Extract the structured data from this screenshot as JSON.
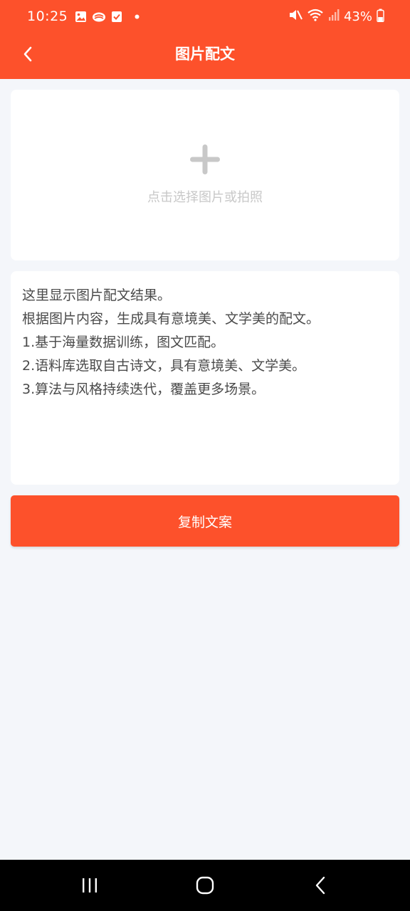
{
  "status_bar": {
    "time": "10:25",
    "battery_percent": "43%",
    "battery_level": 0.43,
    "notification_icons": [
      "image-icon",
      "cloud-icon",
      "check-square-icon",
      "dot-icon"
    ],
    "system_icons": [
      "mute-icon",
      "wifi-icon",
      "signal-icon",
      "battery-icon"
    ]
  },
  "nav": {
    "title": "图片配文",
    "back_icon": "back-chevron-icon"
  },
  "upload": {
    "icon": "plus-icon",
    "hint": "点击选择图片或拍照"
  },
  "result": {
    "lines": [
      "这里显示图片配文结果。",
      "根据图片内容，生成具有意境美、文学美的配文。",
      "1.基于海量数据训练，图文匹配。",
      "2.语料库选取自古诗文，具有意境美、文学美。",
      "3.算法与风格持续迭代，覆盖更多场景。"
    ]
  },
  "actions": {
    "copy_label": "复制文案"
  },
  "system_nav": {
    "icons": [
      "recent-apps-icon",
      "home-icon",
      "back-icon"
    ]
  },
  "colors": {
    "accent": "#fd512b",
    "background": "#f4f6fa",
    "card": "#ffffff",
    "hint_text": "#c8c8c8",
    "body_text": "#4a4a4a"
  }
}
